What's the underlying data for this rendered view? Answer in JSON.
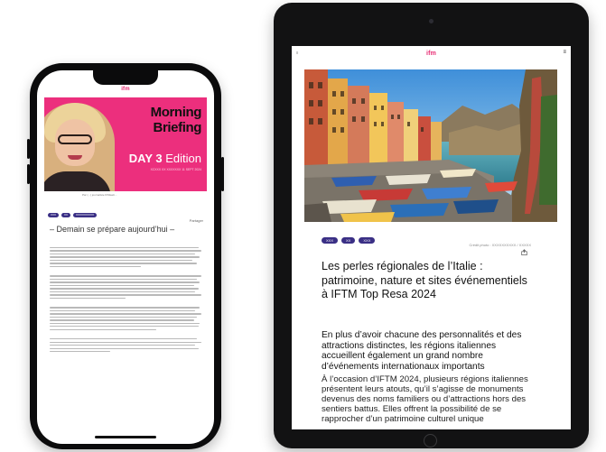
{
  "phone": {
    "logo": "ifm",
    "banner": {
      "title": "Morning Briefing",
      "day": "DAY 3",
      "edition": "Edition",
      "subtitle": "XCXXX XX XXXXXXX 11 SEPT 2024"
    },
    "caption": "Par (...) journaliste IFMweb...",
    "tags": [
      "XXX",
      "XX",
      "XXXXXXXXXX"
    ],
    "share_label": "Partager",
    "heading": "– Demain se prépare aujourd’hui –"
  },
  "tablet": {
    "logo": "ifm",
    "left_label": "≡",
    "menu_icon": "≡",
    "tags": [
      "XXX",
      "XX",
      "XXX"
    ],
    "caption": "Crédit photo : XXXXXXXXXX / XXXXX",
    "share_icon": "share-icon",
    "title": "Les perles régionales de l’Italie : patrimoine, nature et sites événementiels à IFTM Top Resa 2024",
    "lead": "En plus d’avoir chacune des personnalités et des attractions distinctes, les régions italiennes accueillent également un grand nombre d’événements internationaux importants",
    "paragraph": "À l’occasion d’IFTM 2024, plusieurs régions italiennes présentent leurs atouts, qu’il s’agisse de monuments devenus des noms familiers ou d’attractions hors des sentiers battus. Elles offrent la possibilité de se rapprocher d’un patrimoine culturel unique"
  },
  "colors": {
    "brand": "#e72b72",
    "banner": "#ec2f7d",
    "tag": "#3a2f85"
  }
}
